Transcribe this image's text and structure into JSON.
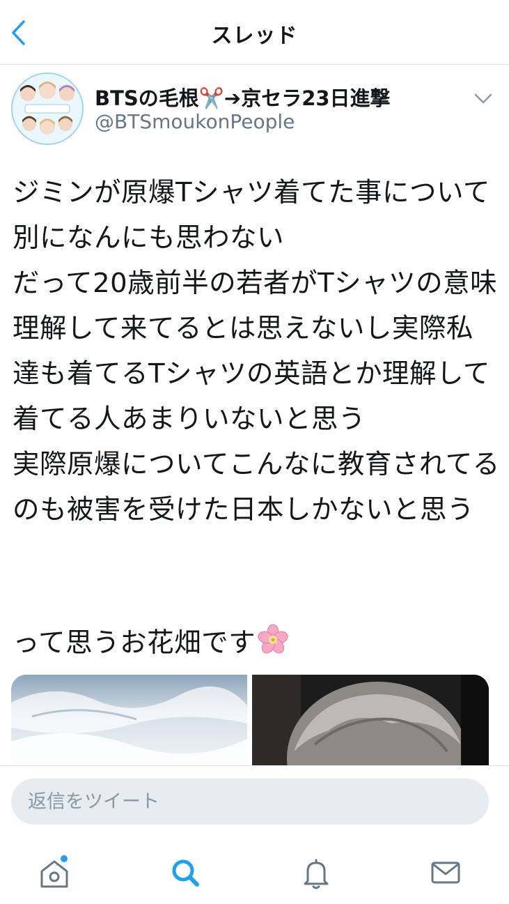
{
  "header": {
    "title": "スレッド"
  },
  "tweet": {
    "display_name": "BTSの毛根",
    "display_name_emoji": "✂️",
    "display_name_suffix": "➔京セラ23日進撃",
    "handle": "@BTSmoukonPeople",
    "body": "ジミンが原爆Tシャツ着てた事について別になんにも思わない\nだって20歳前半の若者がTシャツの意味理解して来てるとは思えないし実際私達も着てるTシャツの英語とか理解して着てる人あまりいないと思う\n実際原爆についてこんなに教育されてるのも被害を受けた日本しかないと思う",
    "body_last": "って思うお花畑です",
    "body_emoji": "🌸"
  },
  "reply": {
    "placeholder": "返信をツイート"
  },
  "tabbar": {
    "tabs": [
      "home",
      "search",
      "notifications",
      "messages"
    ],
    "active": "search",
    "home_has_unread": true
  },
  "colors": {
    "accent": "#1da1f2",
    "text": "#14171a",
    "secondary": "#657786",
    "icon_gray": "#657786",
    "divider": "#e1e8ed"
  }
}
